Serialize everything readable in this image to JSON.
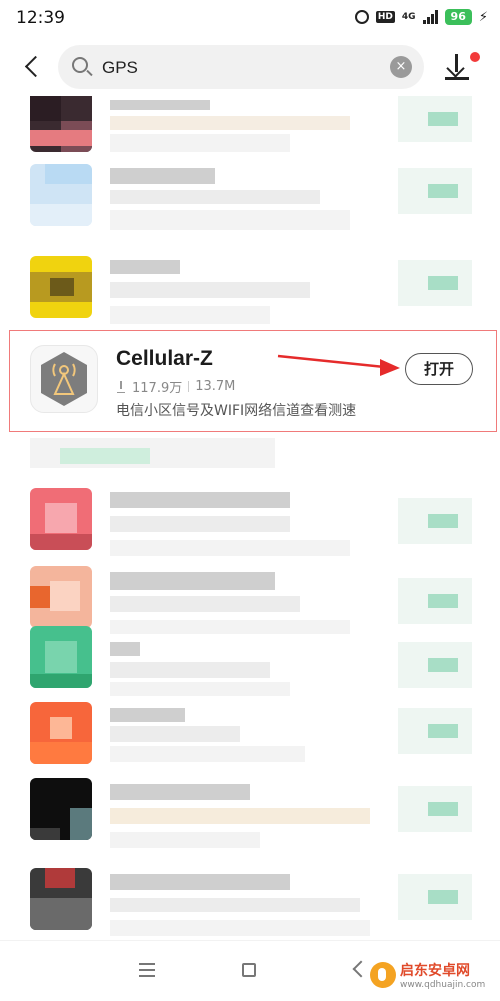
{
  "status_bar": {
    "time": "12:39",
    "network": "4G",
    "hd": "HD",
    "battery": "96"
  },
  "search": {
    "query": "GPS",
    "clear_label": "×"
  },
  "result": {
    "app_name": "Cellular-Z",
    "downloads": "117.9万",
    "size": "13.7M",
    "description": "电信小区信号及WIFI网络信道查看测速",
    "action_label": "打开",
    "icon_name": "tower-icon"
  },
  "watermark": {
    "title": "启东安卓网",
    "url": "www.qdhuajin.com"
  },
  "colors": {
    "highlight_border": "#f07a7a",
    "annotation_arrow": "#e52b2b",
    "battery": "#3bbf5a"
  }
}
